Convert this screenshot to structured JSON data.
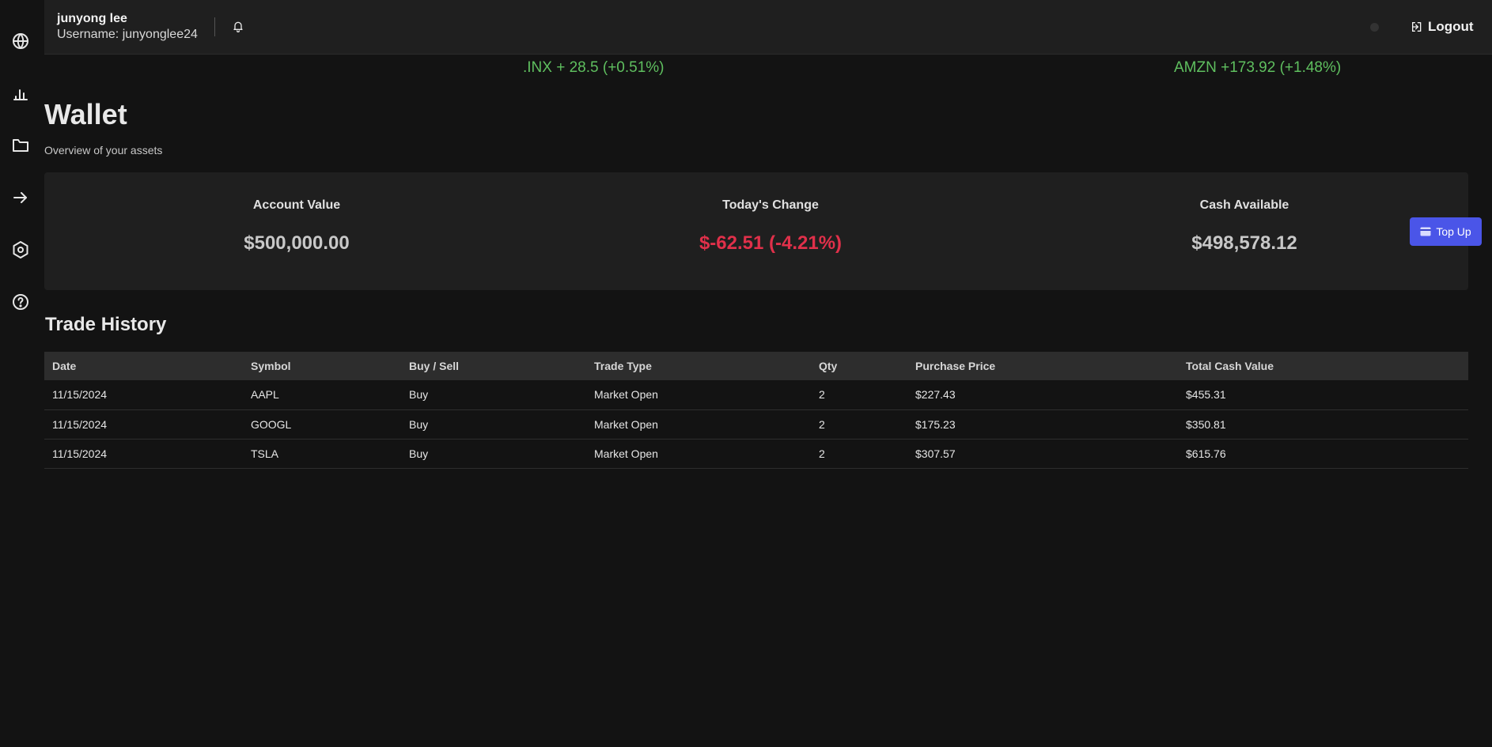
{
  "sidebar": {
    "icons": [
      "globe-icon",
      "bar-chart-icon",
      "folder-icon",
      "arrow-right-icon",
      "settings-hex-icon",
      "help-icon"
    ]
  },
  "header": {
    "user_name": "junyong lee",
    "username_label": "Username: junyonglee24",
    "logout_label": "Logout"
  },
  "ticker": [
    ".INX + 28.5 (+0.51%)",
    "AMZN +173.92 (+1.48%)"
  ],
  "page": {
    "title": "Wallet",
    "subtitle": "Overview of your assets"
  },
  "summary": {
    "account_value_label": "Account Value",
    "account_value": "$500,000.00",
    "todays_change_label": "Today's Change",
    "todays_change": "$-62.51 (-4.21%)",
    "cash_available_label": "Cash Available",
    "cash_available": "$498,578.12",
    "topup_label": "Top Up"
  },
  "colors": {
    "positive": "#5fbf5f",
    "negative": "#e0304a",
    "accent": "#4a55e8"
  },
  "trade_history": {
    "title": "Trade History",
    "columns": [
      "Date",
      "Symbol",
      "Buy / Sell",
      "Trade Type",
      "Qty",
      "Purchase Price",
      "Total Cash Value"
    ],
    "rows": [
      [
        "11/15/2024",
        "AAPL",
        "Buy",
        "Market Open",
        "2",
        "$227.43",
        "$455.31"
      ],
      [
        "11/15/2024",
        "GOOGL",
        "Buy",
        "Market Open",
        "2",
        "$175.23",
        "$350.81"
      ],
      [
        "11/15/2024",
        "TSLA",
        "Buy",
        "Market Open",
        "2",
        "$307.57",
        "$615.76"
      ]
    ]
  }
}
